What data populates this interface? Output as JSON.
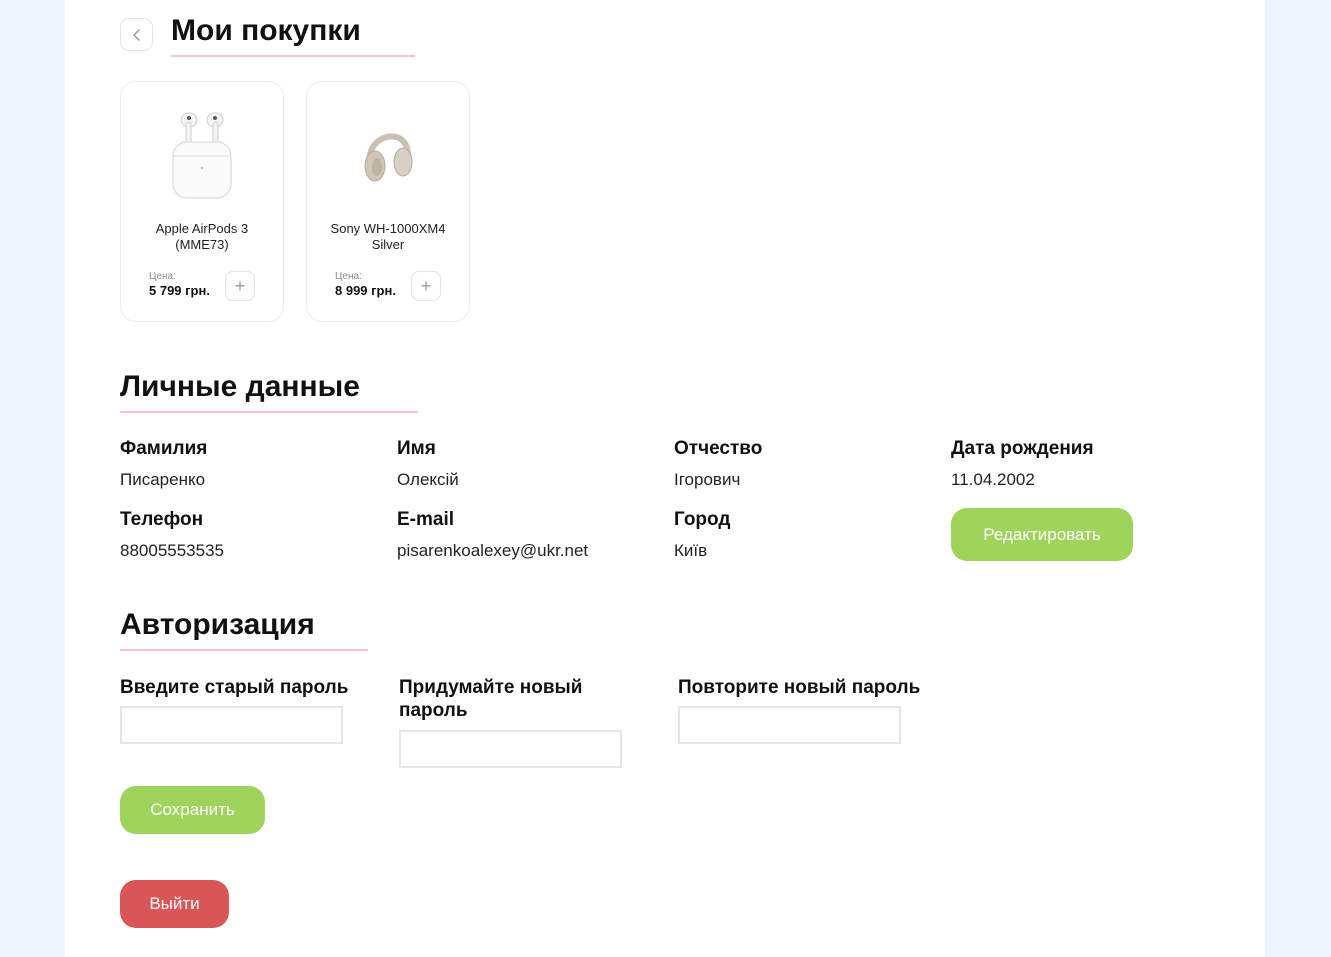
{
  "purchases": {
    "title": "Мои покупки",
    "items": [
      {
        "name": "Apple AirPods 3 (MME73)",
        "price_label": "Цена:",
        "price": "5 799 грн.",
        "image_icon": "airpods-image"
      },
      {
        "name": "Sony WH-1000XM4 Silver",
        "price_label": "Цена:",
        "price": "8 999 грн.",
        "image_icon": "headphones-image"
      }
    ]
  },
  "personal": {
    "title": "Личные данные",
    "fields": {
      "surname": {
        "label": "Фамилия",
        "value": "Писаренко"
      },
      "name": {
        "label": "Имя",
        "value": "Олексій"
      },
      "patronymic": {
        "label": "Отчество",
        "value": "Ігорович"
      },
      "birthdate": {
        "label": "Дата рождения",
        "value": "11.04.2002"
      },
      "phone": {
        "label": "Телефон",
        "value": "88005553535"
      },
      "email": {
        "label": "E-mail",
        "value": "pisarenkoalexey@ukr.net"
      },
      "city": {
        "label": "Город",
        "value": "Київ"
      }
    },
    "edit_label": "Редактировать"
  },
  "auth": {
    "title": "Авторизация",
    "old_password_label": "Введите старый пароль",
    "new_password_label": "Придумайте новый пароль",
    "repeat_password_label": "Повторите новый пароль",
    "old_password_value": "",
    "new_password_value": "",
    "repeat_password_value": "",
    "save_label": "Сохранить"
  },
  "logout_label": "Выйти",
  "colors": {
    "page_bg": "#eef4fe",
    "accent_green": "#9ed45b",
    "danger_red": "#d95658",
    "underline_pink": "#f7c4cc"
  }
}
